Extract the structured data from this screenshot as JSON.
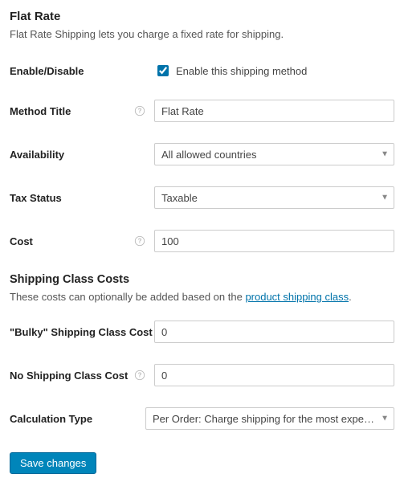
{
  "heading": "Flat Rate",
  "description": "Flat Rate Shipping lets you charge a fixed rate for shipping.",
  "fields": {
    "enable": {
      "label": "Enable/Disable",
      "checkbox_label": "Enable this shipping method",
      "checked": true
    },
    "method_title": {
      "label": "Method Title",
      "value": "Flat Rate"
    },
    "availability": {
      "label": "Availability",
      "value": "All allowed countries"
    },
    "tax_status": {
      "label": "Tax Status",
      "value": "Taxable"
    },
    "cost": {
      "label": "Cost",
      "value": "100"
    }
  },
  "shipping_classes": {
    "heading": "Shipping Class Costs",
    "desc_pre": "These costs can optionally be added based on the ",
    "desc_link": "product shipping class",
    "desc_post": ".",
    "bulky": {
      "label": "\"Bulky\" Shipping Class Cost",
      "value": "0"
    },
    "none": {
      "label": "No Shipping Class Cost",
      "value": "0"
    },
    "calc_type": {
      "label": "Calculation Type",
      "value": "Per Order: Charge shipping for the most expe…"
    }
  },
  "save_button": "Save changes"
}
